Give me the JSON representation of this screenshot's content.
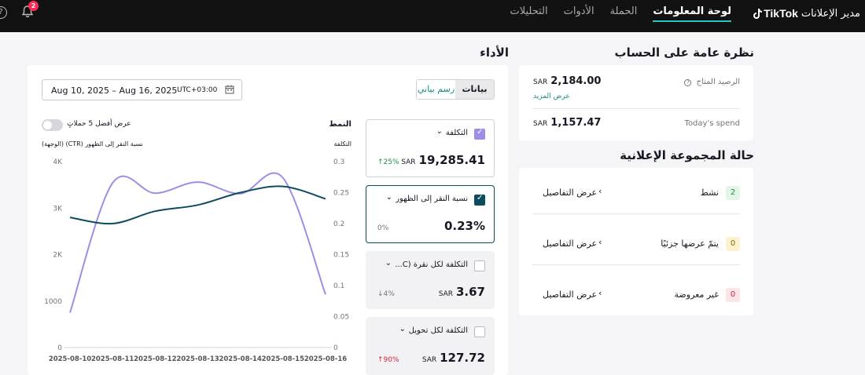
{
  "app": {
    "title": "مدير الإعلانات",
    "brand": "TikTok"
  },
  "nav": {
    "items": [
      {
        "label": "لوحة المعلومات",
        "active": true
      },
      {
        "label": "الحملة",
        "active": false
      },
      {
        "label": "الأدوات",
        "active": false
      },
      {
        "label": "التحليلات",
        "active": false
      }
    ]
  },
  "notifications": {
    "badge": "2"
  },
  "overview": {
    "title": "نظرة عامة على الحساب",
    "balance_label": "الرصيد المتاح",
    "balance_currency": "SAR",
    "balance_value": "2,184.00",
    "more_link": "عرض المزيد",
    "spend_label": "Today's spend",
    "spend_currency": "SAR",
    "spend_value": "1,157.47"
  },
  "adgroup_status": {
    "title": "حالة المجموعة الإعلانية",
    "rows": [
      {
        "count": "2",
        "name": "نشط",
        "link": "عرض التفاصيل"
      },
      {
        "count": "0",
        "name": "يتمّ عرضها جزئيًا",
        "link": "عرض التفاصيل"
      },
      {
        "count": "0",
        "name": "غير معروضة",
        "link": "عرض التفاصيل"
      }
    ]
  },
  "performance": {
    "title": "الأداء",
    "date_range": "Aug 10, 2025 – Aug 16, 2025",
    "timezone": "UTC+03:00",
    "view_toggle": {
      "data": "بيانات",
      "chart": "رسم بياني"
    },
    "top5_label": "عرض أفضل 5 حملاتٍ",
    "mode_label": "النمط",
    "left_axis_title": "نسبة النقر إلى الظهور (CTR) (الوجهة)",
    "right_axis_title": "التكلفة",
    "metrics": [
      {
        "name": "التكلفة",
        "currency": "SAR",
        "value": "19,285.41",
        "delta": "↑25%"
      },
      {
        "name": "نسبة النقر إلى الظهور",
        "currency": "",
        "value": "0.23%",
        "delta": "0%"
      },
      {
        "name": "التكلفة لكل نقرة (C...",
        "currency": "SAR",
        "value": "3.67",
        "delta": "↓4%"
      },
      {
        "name": "التكلفة لكل تحويل",
        "currency": "SAR",
        "value": "127.72",
        "delta": "↑90%"
      }
    ]
  },
  "chart_data": {
    "type": "line",
    "x": [
      "2025-08-10",
      "2025-08-11",
      "2025-08-12",
      "2025-08-13",
      "2025-08-14",
      "2025-08-15",
      "2025-08-16"
    ],
    "series": [
      {
        "name": "التكلفة",
        "color": "#9b8fe6",
        "axis": "left",
        "values": [
          750,
          3540,
          3320,
          3560,
          3310,
          3650,
          1140
        ]
      },
      {
        "name": "نسبة النقر إلى الظهور",
        "color": "#0c4c5e",
        "axis": "right",
        "values": [
          0.21,
          0.2,
          0.22,
          0.23,
          0.25,
          0.26,
          0.24
        ]
      }
    ],
    "left_ticks": [
      "4K",
      "3K",
      "2K",
      "1000",
      "0"
    ],
    "right_ticks": [
      "0.3",
      "0.25",
      "0.2",
      "0.15",
      "0.1",
      "0.05",
      "0"
    ],
    "ylim_left": [
      0,
      4000
    ],
    "ylim_right": [
      0,
      0.3
    ]
  }
}
